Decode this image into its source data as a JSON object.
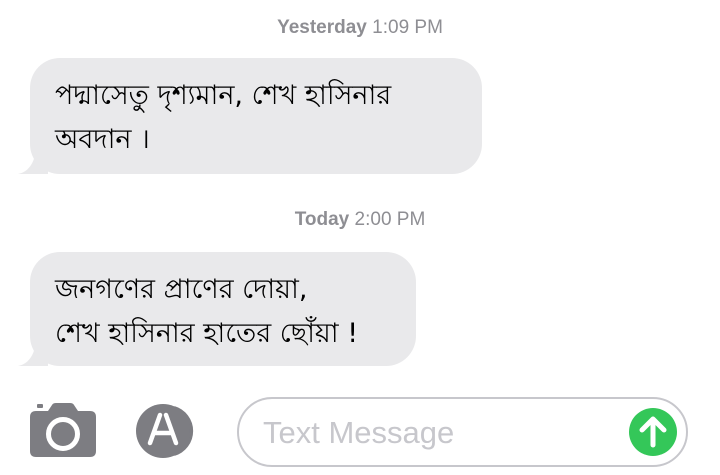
{
  "conversation": {
    "groups": [
      {
        "day": "Yesterday",
        "time": "1:09 PM",
        "message_lines": [
          "পদ্মাসেতু দৃশ্যমান, শেখ হাসিনার",
          "অবদান ।"
        ]
      },
      {
        "day": "Today",
        "time": "2:00 PM",
        "message_lines": [
          "জনগণের প্রাণের দোয়া,",
          "শেখ হাসিনার হাতের ছোঁয়া !"
        ]
      }
    ]
  },
  "input_bar": {
    "placeholder": "Text Message",
    "camera_icon": "camera-icon",
    "app_store_icon": "app-store-icon",
    "send_icon": "arrow-up-icon"
  },
  "colors": {
    "bubble_background": "#e9e9eb",
    "timestamp_text": "#8e8e93",
    "send_button": "#34c759",
    "input_border": "#c7c7cc",
    "icon_gray": "#7d7d82"
  }
}
